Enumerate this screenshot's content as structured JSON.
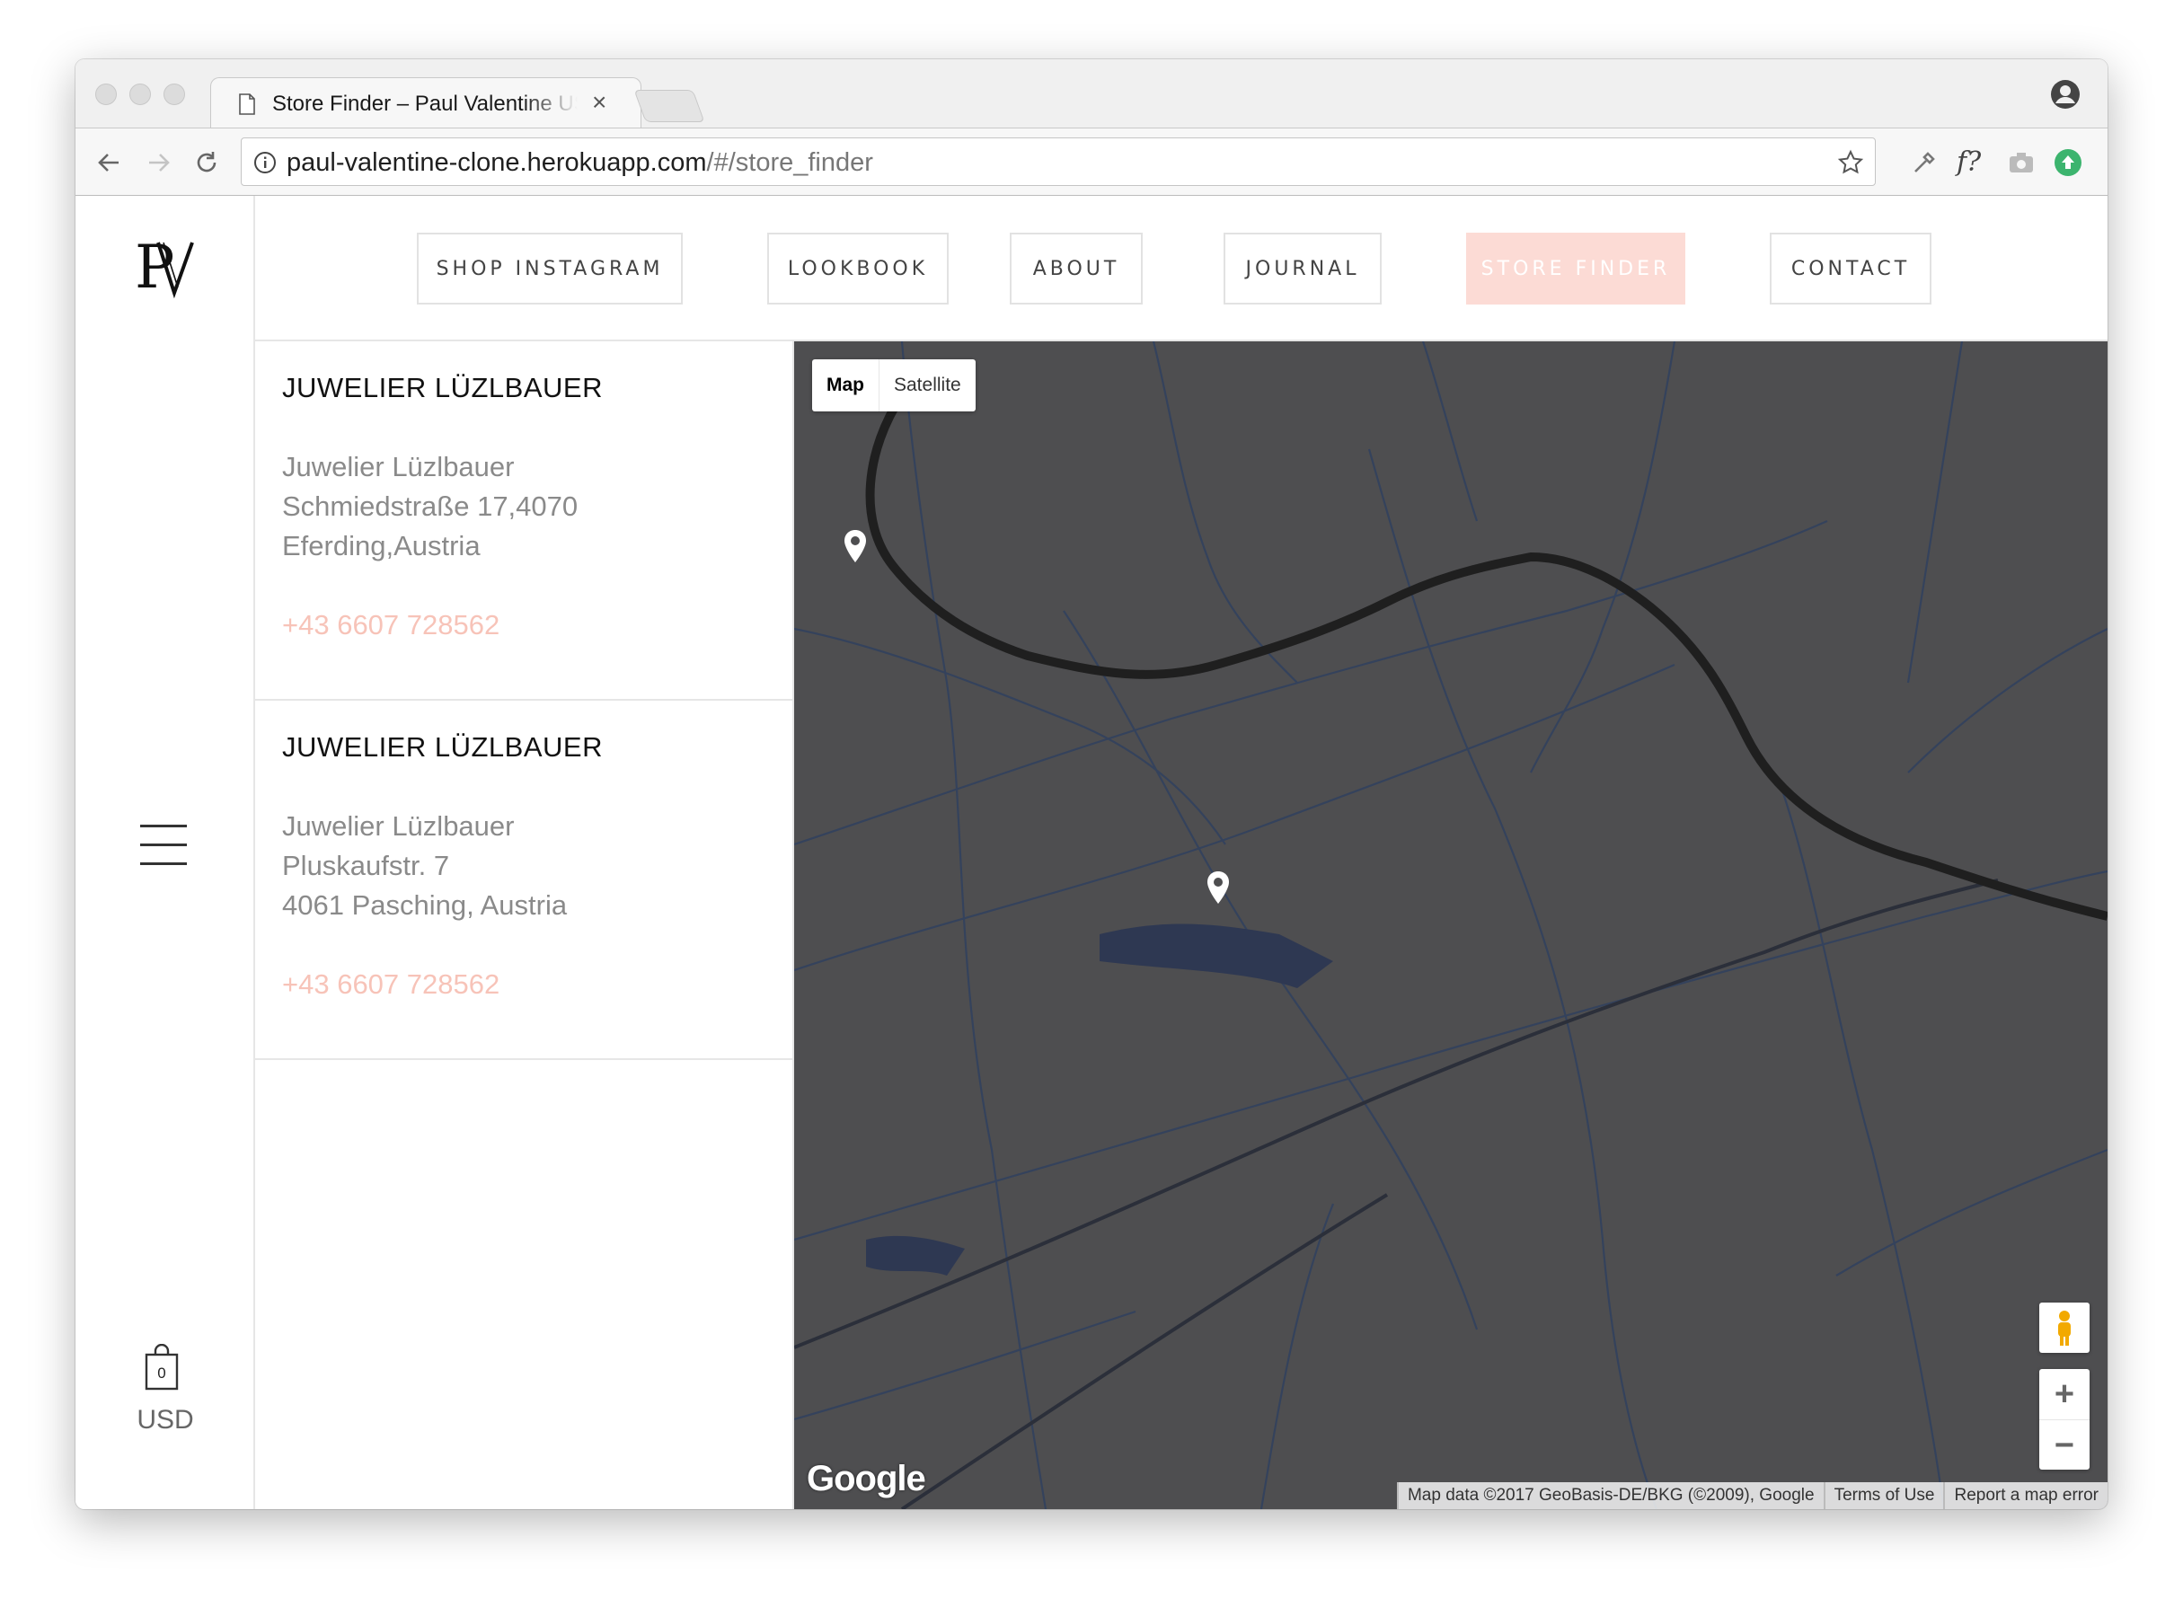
{
  "browser": {
    "tab_title": "Store Finder – Paul Valentine US",
    "tab_close": "×",
    "url_host": "paul-valentine-clone.herokuapp.com",
    "url_path": "/#/store_finder"
  },
  "brand": {
    "logo_text": "PV"
  },
  "nav": [
    {
      "label": "SHOP INSTAGRAM",
      "active": false
    },
    {
      "label": "LOOKBOOK",
      "active": false
    },
    {
      "label": "ABOUT",
      "active": false
    },
    {
      "label": "JOURNAL",
      "active": false
    },
    {
      "label": "STORE FINDER",
      "active": true
    },
    {
      "label": "CONTACT",
      "active": false
    }
  ],
  "sidebar": {
    "cart_count": "0",
    "currency": "USD"
  },
  "stores": [
    {
      "name": "JUWELIER LÜZLBAUER",
      "lines": [
        "Juwelier Lüzlbauer",
        "Schmiedstraße 17,4070",
        "Eferding,Austria"
      ],
      "phone": "+43 6607 728562"
    },
    {
      "name": "JUWELIER LÜZLBAUER",
      "lines": [
        "Juwelier Lüzlbauer",
        "Pluskaufstr. 7",
        "4061 Pasching, Austria"
      ],
      "phone": "+43 6607 728562"
    }
  ],
  "map": {
    "type_map": "Map",
    "type_satellite": "Satellite",
    "zoom_in": "+",
    "zoom_out": "−",
    "logo": "Google",
    "attribution": "Map data ©2017 GeoBasis-DE/BKG (©2009), Google",
    "terms": "Terms of Use",
    "report": "Report a map error",
    "background_color": "#4e4e50",
    "river_color": "#1f1f1f",
    "road_color": "#3a4a66"
  },
  "colors": {
    "accent": "#fcdbd5",
    "phone": "#f7c3b8"
  }
}
